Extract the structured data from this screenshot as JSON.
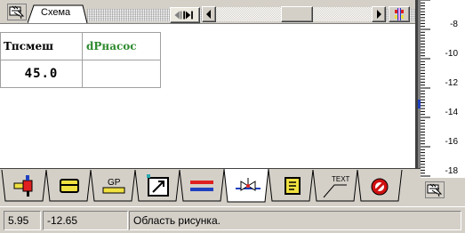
{
  "top": {
    "tab_label": "Схема"
  },
  "table": {
    "header": [
      "Тпсмеш",
      "dPнасос"
    ],
    "row": [
      "45.0",
      ""
    ]
  },
  "ruler": {
    "labels": [
      "-8",
      "-10",
      "-12",
      "-14",
      "-16",
      "-18"
    ]
  },
  "tools": {
    "tabs": [
      "pump-tab",
      "pipe-tab",
      "gp-tab",
      "resize-tab",
      "flow-tab",
      "valve-tab",
      "doc-tab",
      "text-tab",
      "forbid-tab"
    ],
    "gp_text": "GP",
    "text_text": "TEXT"
  },
  "status": {
    "x": "5.95",
    "y": "-12.65",
    "message": "Область рисунка."
  },
  "colors": {
    "header_green": "#2e8b2e",
    "flow_red": "#e02020",
    "flow_blue": "#2040c0",
    "forbid_red": "#d01010",
    "select_yellow": "#f0e040"
  }
}
